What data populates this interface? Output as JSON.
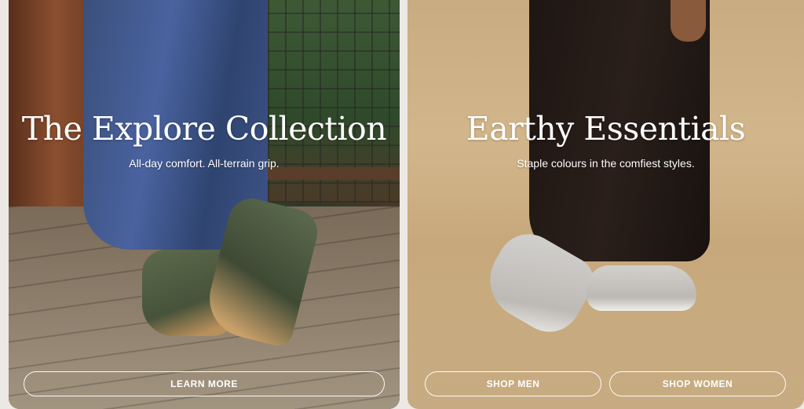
{
  "cards": [
    {
      "title": "The Explore Collection",
      "subtitle": "All-day comfort. All-terrain grip.",
      "buttons": [
        "LEARN MORE"
      ]
    },
    {
      "title": "Earthy Essentials",
      "subtitle": "Staple colours in the comfiest styles.",
      "buttons": [
        "SHOP MEN",
        "SHOP WOMEN"
      ]
    }
  ],
  "colors": {
    "text": "#ffffff",
    "right_card_background": "#cdb084",
    "page_background": "#ece9e4"
  }
}
